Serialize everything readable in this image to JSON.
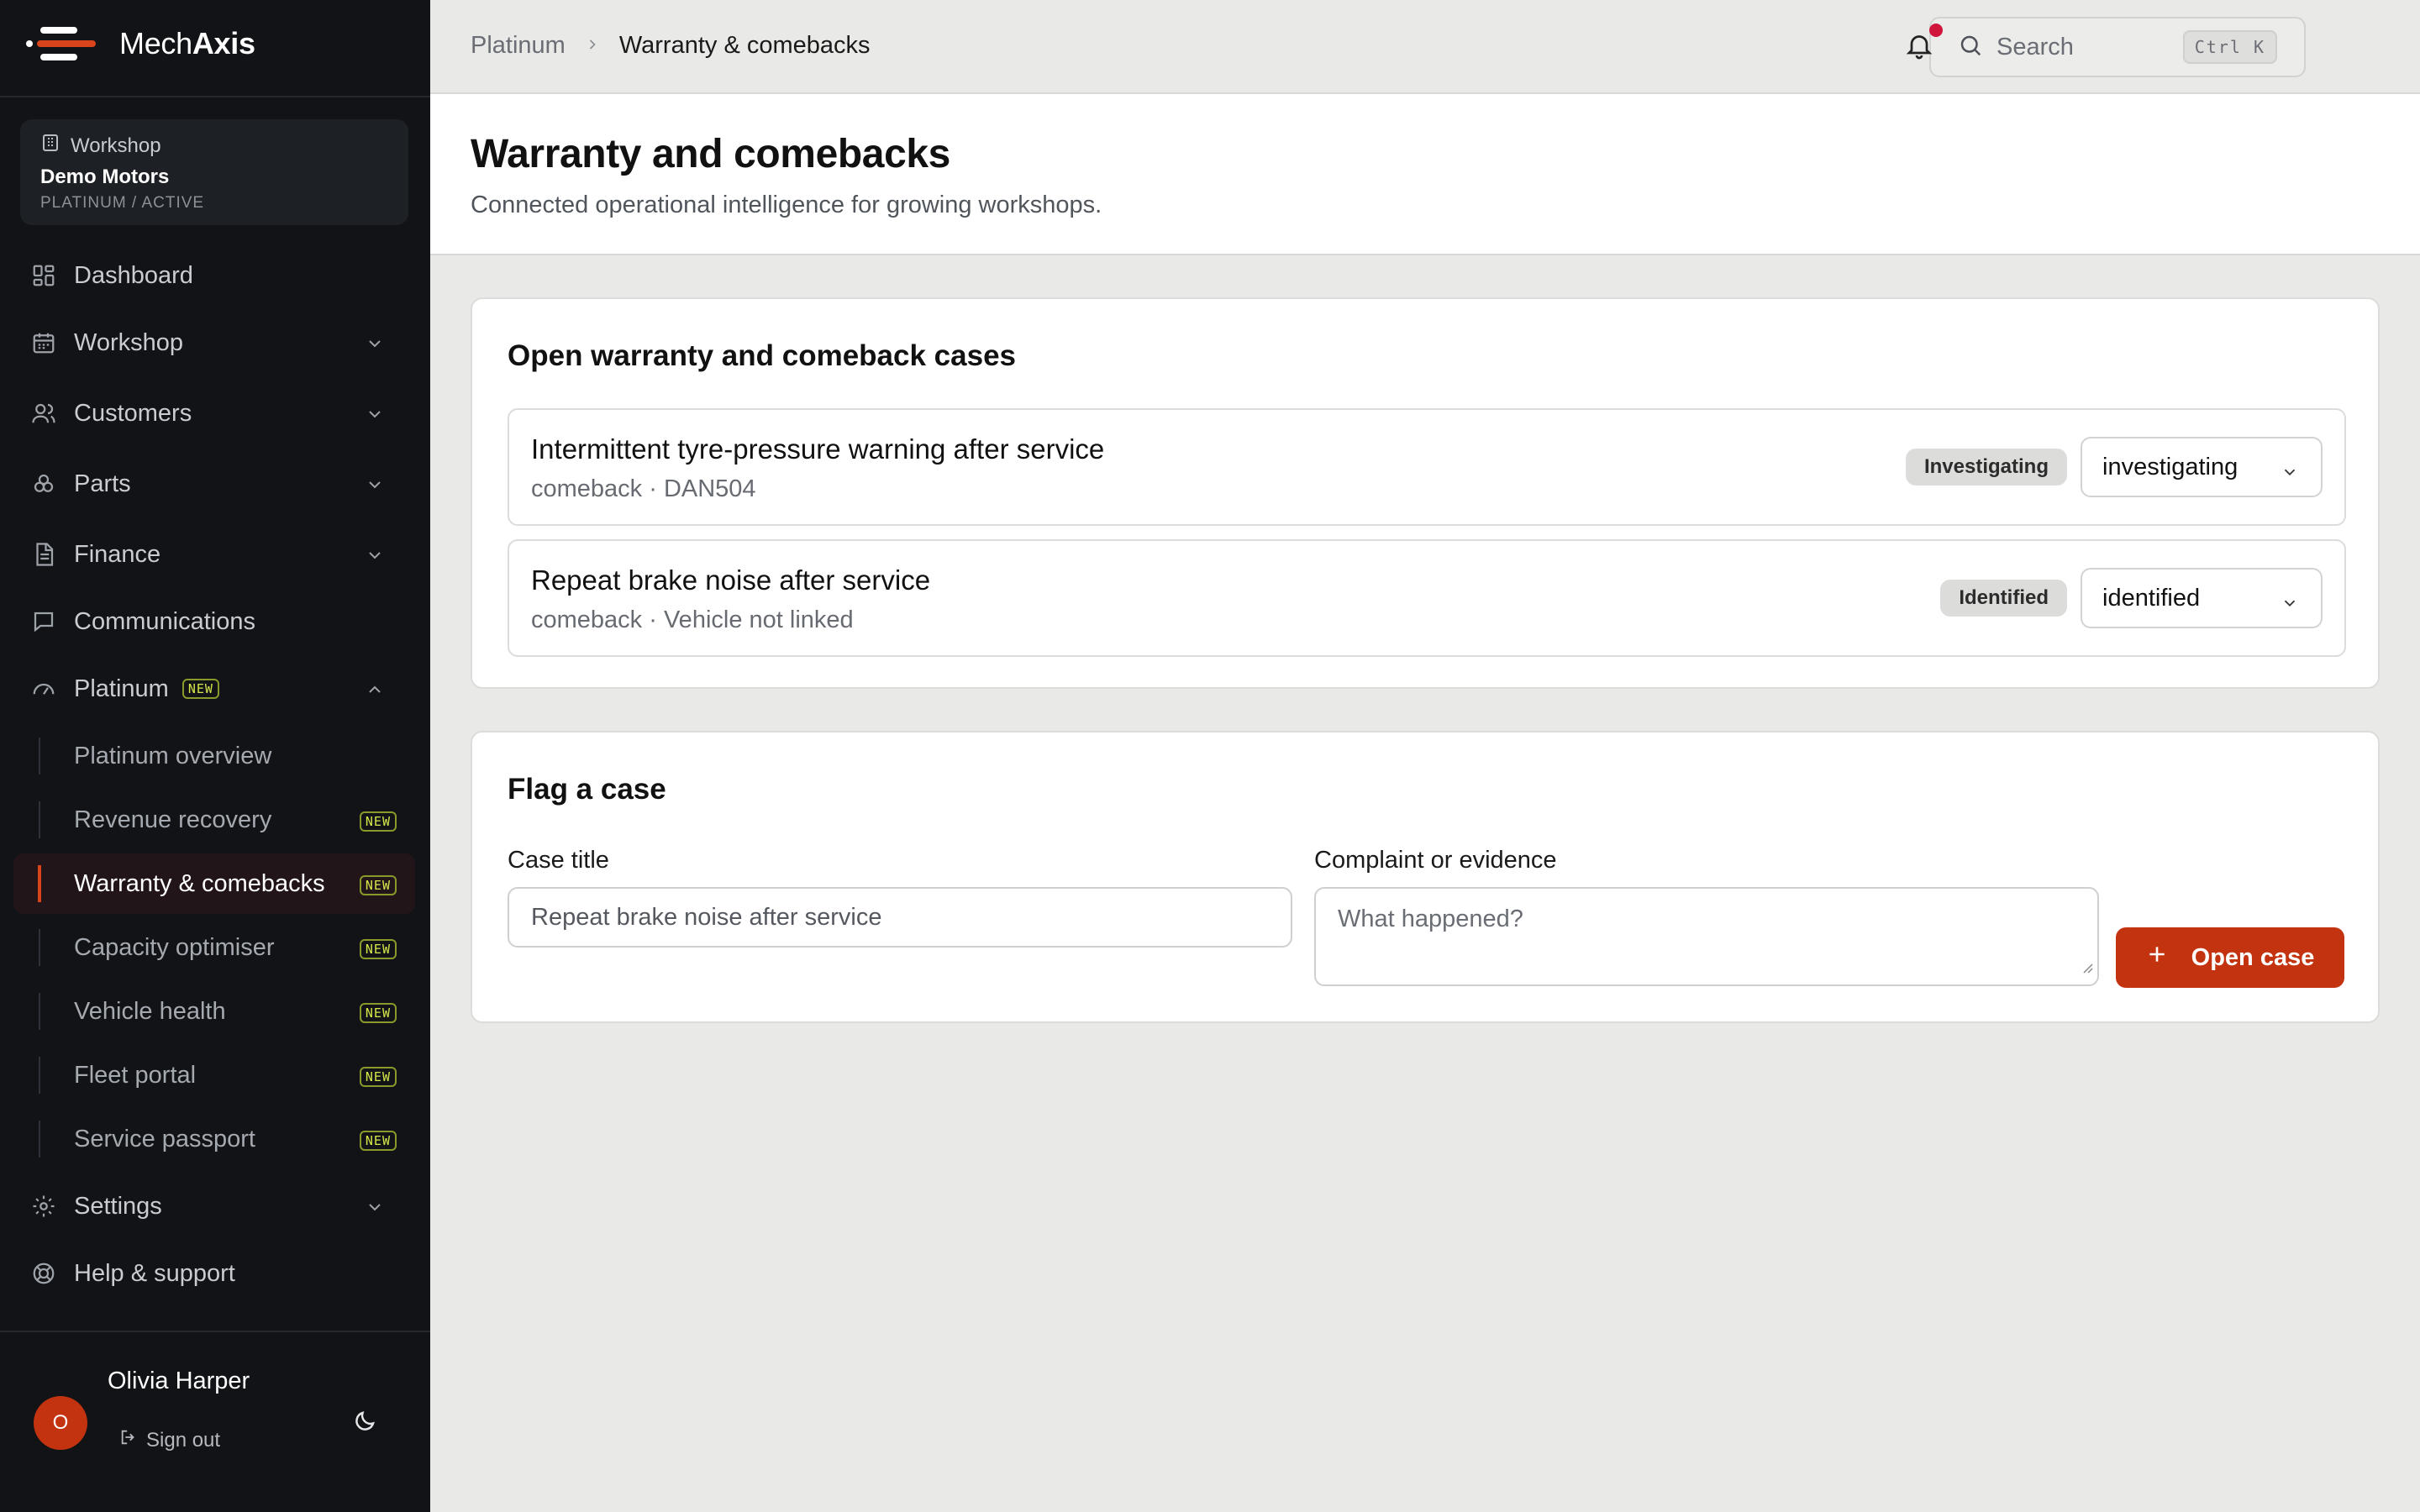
{
  "brand": {
    "name_light": "Mech",
    "name_bold": "Axis"
  },
  "workshop": {
    "label": "Workshop",
    "name": "Demo Motors",
    "status": "PLATINUM / ACTIVE"
  },
  "nav": {
    "dashboard": "Dashboard",
    "workshop": "Workshop",
    "customers": "Customers",
    "parts": "Parts",
    "finance": "Finance",
    "communications": "Communications",
    "platinum": "Platinum",
    "platinum_badge": "NEW",
    "settings": "Settings",
    "help": "Help & support"
  },
  "platinum_items": [
    {
      "label": "Platinum overview",
      "badge": ""
    },
    {
      "label": "Revenue recovery",
      "badge": "NEW"
    },
    {
      "label": "Warranty & comebacks",
      "badge": "NEW"
    },
    {
      "label": "Capacity optimiser",
      "badge": "NEW"
    },
    {
      "label": "Vehicle health",
      "badge": "NEW"
    },
    {
      "label": "Fleet portal",
      "badge": "NEW"
    },
    {
      "label": "Service passport",
      "badge": "NEW"
    }
  ],
  "user": {
    "initial": "O",
    "name": "Olivia Harper",
    "signout": "Sign out"
  },
  "topbar": {
    "crumb_parent": "Platinum",
    "crumb_current": "Warranty & comebacks",
    "search_placeholder": "Search",
    "search_shortcut": "Ctrl K"
  },
  "page": {
    "title": "Warranty and comebacks",
    "subtitle": "Connected operational intelligence for growing workshops."
  },
  "cases_card": {
    "title": "Open warranty and comeback cases",
    "cases": [
      {
        "title": "Intermittent tyre-pressure warning after service",
        "meta": "comeback · DAN504",
        "status_badge": "Investigating",
        "status_value": "investigating"
      },
      {
        "title": "Repeat brake noise after service",
        "meta": "comeback · Vehicle not linked",
        "status_badge": "Identified",
        "status_value": "identified"
      }
    ]
  },
  "flag_card": {
    "title": "Flag a case",
    "case_title_label": "Case title",
    "case_title_value": "Repeat brake noise after service",
    "complaint_label": "Complaint or evidence",
    "complaint_placeholder": "What happened?",
    "submit_label": "Open case"
  },
  "colors": {
    "sidebar_bg": "#111316",
    "accent": "#c3330f",
    "badge_text": "#d6e64a",
    "notification_dot": "#d0163b",
    "page_bg": "#e9e9e8"
  },
  "icons": [
    "brand-logo-icon",
    "building-icon",
    "dashboard-grid-icon",
    "calendar-icon",
    "users-icon",
    "parts-icon",
    "document-icon",
    "chat-icon",
    "gauge-icon",
    "gear-icon",
    "lifebuoy-icon",
    "chevron-down-icon",
    "chevron-up-icon",
    "chevron-right-icon",
    "search-icon",
    "bell-icon",
    "moon-icon",
    "sign-out-icon",
    "plus-icon"
  ]
}
